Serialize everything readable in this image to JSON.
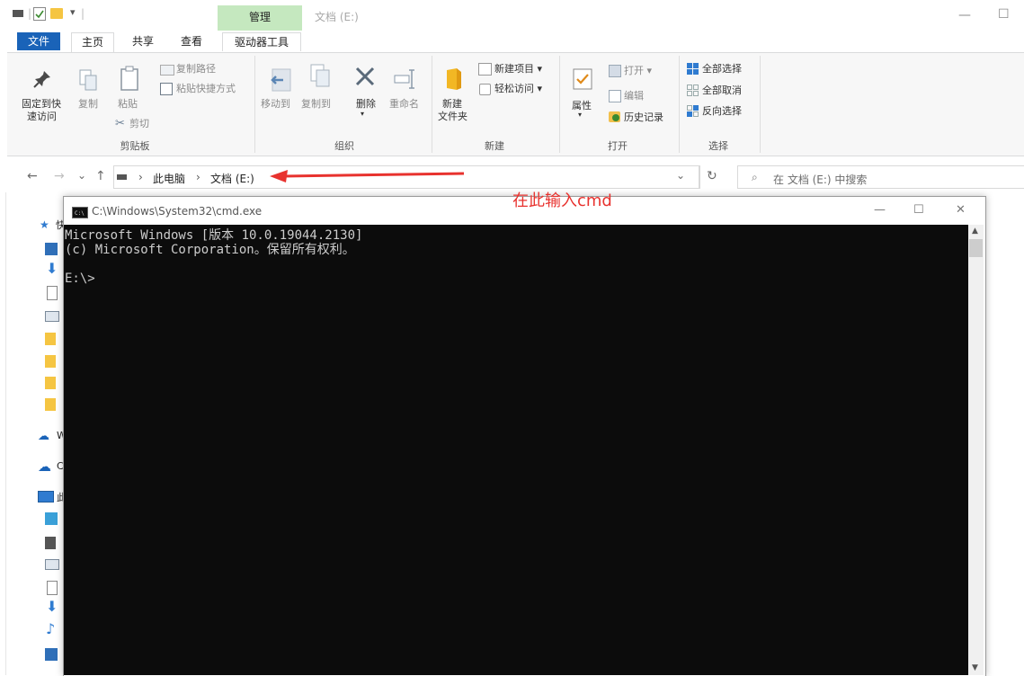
{
  "titlebar": {
    "manage_label": "管理",
    "window_title": "文档 (E:)",
    "minimize": "—",
    "maximize": "☐"
  },
  "tabs": {
    "file": "文件",
    "home": "主页",
    "share": "共享",
    "view": "查看",
    "drive_tools": "驱动器工具"
  },
  "ribbon": {
    "clipboard": {
      "pin_line1": "固定到快",
      "pin_line2": "速访问",
      "copy": "复制",
      "paste": "粘贴",
      "copy_path": "复制路径",
      "paste_shortcut": "粘贴快捷方式",
      "cut": "剪切",
      "group": "剪贴板"
    },
    "organize": {
      "move_to": "移动到",
      "copy_to": "复制到",
      "delete": "删除",
      "rename": "重命名",
      "group": "组织"
    },
    "new": {
      "new_folder_line1": "新建",
      "new_folder_line2": "文件夹",
      "new_item": "新建项目 ▾",
      "easy_access": "轻松访问 ▾",
      "group": "新建"
    },
    "open": {
      "properties": "属性",
      "open": "打开 ▾",
      "edit": "编辑",
      "history": "历史记录",
      "group": "打开"
    },
    "select": {
      "select_all": "全部选择",
      "select_none": "全部取消",
      "invert": "反向选择",
      "group": "选择"
    }
  },
  "address": {
    "back": "←",
    "forward": "→",
    "recent": "⌄",
    "up": "↑",
    "crumb_sep1": "›",
    "crumb_pc": "此电脑",
    "crumb_sep2": "›",
    "crumb_drive": "文档 (E:)",
    "dropdown": "⌄",
    "refresh": "↻",
    "search_placeholder": "在 文档 (E:) 中搜索"
  },
  "navpane": {
    "quick_access_partial": "快",
    "onedrive_partial": "W",
    "cloud_partial": "C",
    "thispc_partial": "此"
  },
  "cmd": {
    "title": "C:\\Windows\\System32\\cmd.exe",
    "line1": "Microsoft Windows [版本 10.0.19044.2130]",
    "line2": "(c) Microsoft Corporation。保留所有权利。",
    "prompt": "E:\\>",
    "minimize": "—",
    "maximize": "☐",
    "close": "✕"
  },
  "annotation": {
    "text": "在此输入cmd",
    "color": "#e8322e"
  },
  "colors": {
    "file_tab": "#1a63b8",
    "manage_band": "#c5e8bf",
    "cmd_bg": "#0c0c0c",
    "annotation": "#e8322e"
  }
}
